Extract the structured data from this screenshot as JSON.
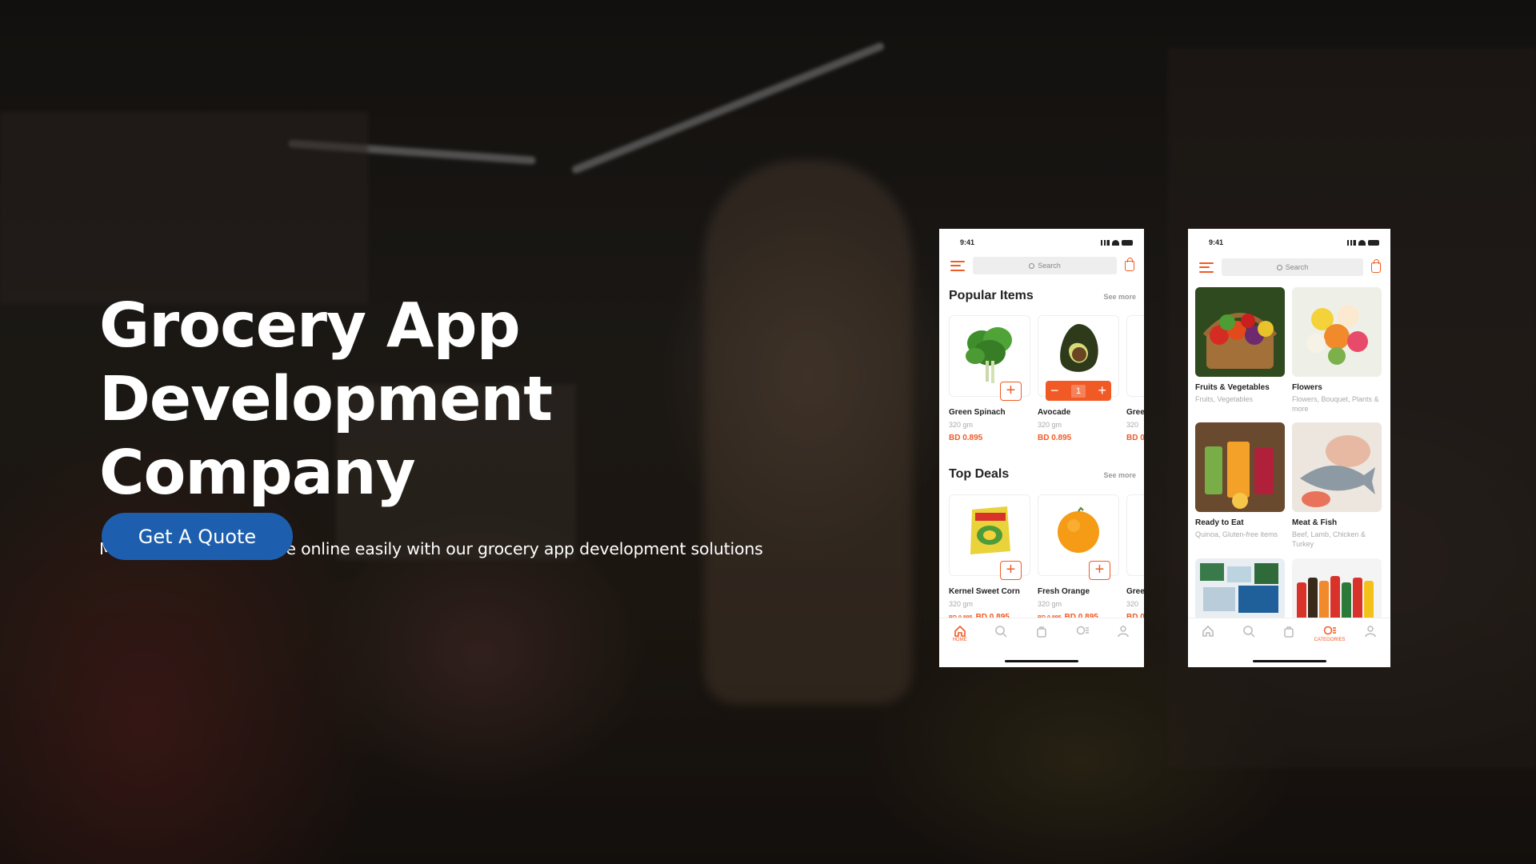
{
  "hero": {
    "title_line1": "Grocery App",
    "title_line2": "Development Company",
    "subtitle": "Move your grocery store online easily with our grocery app development solutions",
    "cta_label": "Get A Quote"
  },
  "colors": {
    "accent_orange": "#f15a24",
    "cta_blue": "#1d5fae"
  },
  "phone_home": {
    "time": "9:41",
    "search_placeholder": "Search",
    "popular": {
      "title": "Popular Items",
      "see_more": "See more",
      "items": [
        {
          "name": "Green Spinach",
          "weight": "320 gm",
          "price": "BD 0.895",
          "icon": "spinach-image"
        },
        {
          "name": "Avocade",
          "weight": "320 gm",
          "price": "BD 0.895",
          "quantity": "1",
          "icon": "avocado-image"
        },
        {
          "name": "Gree",
          "weight": "320",
          "price": "BD 0"
        }
      ]
    },
    "deals": {
      "title": "Top Deals",
      "see_more": "See more",
      "items": [
        {
          "name": "Kernel Sweet Corn",
          "weight": "320 gm",
          "old_price": "BD 0.895",
          "price": "BD 0.895",
          "icon": "corn-pack-image"
        },
        {
          "name": "Fresh Orange",
          "weight": "320 gm",
          "old_price": "BD 0.895",
          "price": "BD 0.895",
          "icon": "orange-image"
        },
        {
          "name": "Gree",
          "weight": "320",
          "price": "BD 0"
        }
      ]
    },
    "tabs": [
      {
        "label": "HOME",
        "icon": "home-icon",
        "active": true
      },
      {
        "label": "",
        "icon": "search-icon"
      },
      {
        "label": "",
        "icon": "bag-icon"
      },
      {
        "label": "",
        "icon": "categories-icon"
      },
      {
        "label": "",
        "icon": "profile-icon"
      }
    ]
  },
  "phone_categories": {
    "time": "9:41",
    "search_placeholder": "Search",
    "categories": [
      {
        "name": "Fruits & Vegetables",
        "sub": "Fruits, Vegetables",
        "icon": "vegetable-basket-image"
      },
      {
        "name": "Flowers",
        "sub": "Flowers, Bouquet, Plants & more",
        "icon": "flowers-image"
      },
      {
        "name": "Ready to Eat",
        "sub": "Quinoa, Gluten-free items",
        "icon": "juice-image"
      },
      {
        "name": "Meat & Fish",
        "sub": "Beef, Lamb, Chicken & Turkey",
        "icon": "meat-fish-image"
      },
      {
        "name": "",
        "sub": "",
        "icon": "packaged-food-image"
      },
      {
        "name": "",
        "sub": "",
        "icon": "beverages-image"
      }
    ],
    "tabs": [
      {
        "label": "",
        "icon": "home-icon"
      },
      {
        "label": "",
        "icon": "search-icon"
      },
      {
        "label": "",
        "icon": "bag-icon"
      },
      {
        "label": "CATEGORIES",
        "icon": "categories-icon",
        "active": true
      },
      {
        "label": "",
        "icon": "profile-icon"
      }
    ]
  }
}
